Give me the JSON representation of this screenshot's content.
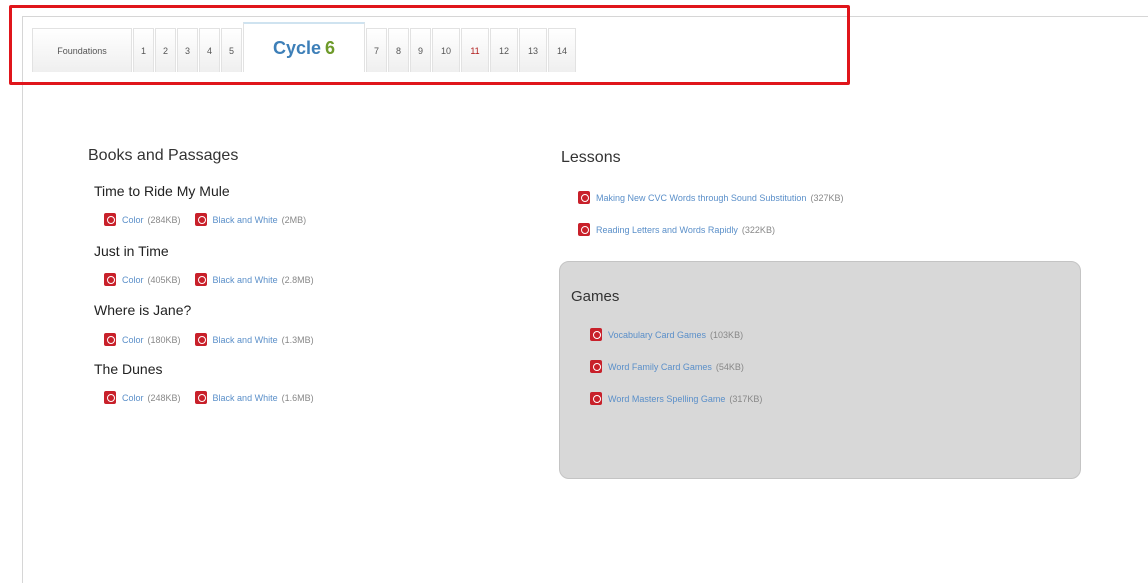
{
  "tabs": [
    {
      "label": "Foundations"
    },
    {
      "label": "1"
    },
    {
      "label": "2"
    },
    {
      "label": "3"
    },
    {
      "label": "4"
    },
    {
      "label": "5"
    },
    {
      "label": "Cycle",
      "number": "6"
    },
    {
      "label": "7"
    },
    {
      "label": "8"
    },
    {
      "label": "9"
    },
    {
      "label": "10"
    },
    {
      "label": "11"
    },
    {
      "label": "12"
    },
    {
      "label": "13"
    },
    {
      "label": "14"
    }
  ],
  "books_section": {
    "title": "Books and Passages",
    "books": [
      {
        "title": "Time to Ride My Mule",
        "color_label": "Color",
        "color_size": "(284KB)",
        "bw_label": "Black and White",
        "bw_size": "(2MB)"
      },
      {
        "title": "Just in Time",
        "color_label": "Color",
        "color_size": "(405KB)",
        "bw_label": "Black and White",
        "bw_size": "(2.8MB)"
      },
      {
        "title": "Where is Jane?",
        "color_label": "Color",
        "color_size": "(180KB)",
        "bw_label": "Black and White",
        "bw_size": "(1.3MB)"
      },
      {
        "title": "The Dunes",
        "color_label": "Color",
        "color_size": "(248KB)",
        "bw_label": "Black and White",
        "bw_size": "(1.6MB)"
      }
    ]
  },
  "lessons_section": {
    "title": "Lessons",
    "items": [
      {
        "label": "Making New CVC Words through Sound Substitution",
        "size": "(327KB)"
      },
      {
        "label": "Reading Letters and Words Rapidly",
        "size": "(322KB)"
      }
    ]
  },
  "games_section": {
    "title": "Games",
    "items": [
      {
        "label": "Vocabulary Card Games",
        "size": "(103KB)"
      },
      {
        "label": "Word Family Card Games",
        "size": "(54KB)"
      },
      {
        "label": "Word Masters Spelling Game",
        "size": "(317KB)"
      }
    ]
  },
  "colors": {
    "highlight": "#e0151b",
    "link": "#5a8fc9",
    "pdf": "#c8202a",
    "active_tab": "#3d7fb8"
  }
}
